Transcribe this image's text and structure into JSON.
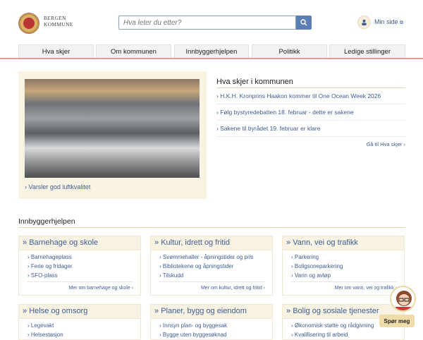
{
  "header": {
    "logo_line1": "BERGEN",
    "logo_line2": "KOMMUNE",
    "search_placeholder": "Hva leter du etter?",
    "min_side": "Min side"
  },
  "nav": [
    "Hva skjer",
    "Om kommunen",
    "Innbyggerhjelpen",
    "Politikk",
    "Ledige stillinger"
  ],
  "feature": {
    "link": "Varsler god luftkvalitet"
  },
  "news": {
    "title": "Hva skjer i kommunen",
    "items": [
      "H.K.H. Kronprins Haakon kommer til One Ocean Week 2026",
      "Følg bystyredebatten 18. februar - dette er sakene",
      "Sakene til byrådet 19. februar er klare"
    ],
    "more": "Gå til Hva skjer ›"
  },
  "help": {
    "title": "Innbyggerhjelpen",
    "cards": [
      {
        "title": "Barnehage og skole",
        "links": [
          "Barnehageplass",
          "Ferie og fridager",
          "SFO-plass"
        ],
        "more": "Mer om barnehage og skole ›"
      },
      {
        "title": "Kultur, idrett og fritid",
        "links": [
          "Svømmehaller - åpningstider og pris",
          "Bibliotekene og åpningstider",
          "Tilskudd"
        ],
        "more": "Mer om kultur, idrett og fritid ›"
      },
      {
        "title": "Vann, vei og trafikk",
        "links": [
          "Parkering",
          "Boligsoneparkering",
          "Vann og avløp"
        ],
        "more": "Mer om vann, vei og trafikk ›"
      },
      {
        "title": "Helse og omsorg",
        "links": [
          "Legevakt",
          "Helsestasjon"
        ]
      },
      {
        "title": "Planer, bygg og eiendom",
        "links": [
          "Innsyn plan- og byggesak",
          "Bygge uten byggesøknad"
        ]
      },
      {
        "title": "Bolig og sosiale tjenester",
        "links": [
          "Økonomisk støtte og rådgivning",
          "Kvalifisering til arbeid"
        ]
      }
    ]
  },
  "chat": {
    "label": "Spør meg"
  }
}
